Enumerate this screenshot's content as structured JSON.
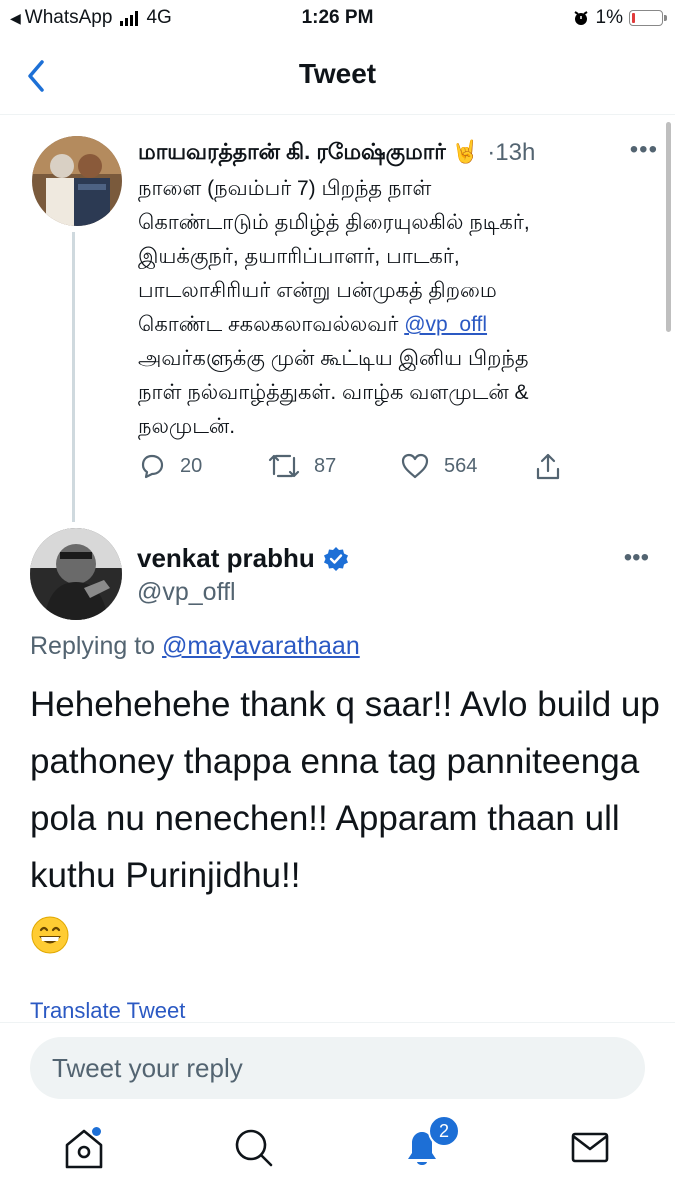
{
  "status_bar": {
    "back_app": "WhatsApp",
    "network": "4G",
    "time": "1:26 PM",
    "battery": "1%",
    "battery_level": 0.01
  },
  "nav": {
    "title": "Tweet",
    "back_icon": "chevron-left-icon"
  },
  "tweets": [
    {
      "display_name": "மாயவரத்தான் கி. ரமேஷ்குமார் 🤘",
      "time": "·13h",
      "text_before": "நாளை (நவம்பர் 7) பிறந்த நாள்\nகொண்டாடும் தமிழ்த் திரையுலகில் நடிகர்,\nஇயக்குநர், தயாரிப்பாளர், பாடகர்,\nபாடலாசிரியர் என்று பன்முகத் திறமை\nகொண்ட சகலகலாவல்லவர் ",
      "mention": "@vp_offl",
      "text_after": "\nஅவர்களுக்கு முன் கூட்டிய இனிய பிறந்த\nநாள் நல்வாழ்த்துகள். வாழ்க வளமுடன் &\nநலமுடன்.",
      "replies": "20",
      "retweets": "87",
      "likes": "564"
    },
    {
      "display_name": "venkat prabhu",
      "handle": "@vp_offl",
      "verified": true,
      "replying_label": "Replying to",
      "replying_to": "@mayavarathaan",
      "text": "Hehehehehe thank q saar!! Avlo build up pathoney thappa enna tag panniteenga pola nu nenechen!! Apparam thaan ull kuthu Purinjidhu!!",
      "emoji": "grinning-face-with-smiling-eyes"
    }
  ],
  "translate_label": "Translate Tweet",
  "reply": {
    "placeholder": "Tweet your reply"
  },
  "tabbar": {
    "home_icon": "home-icon",
    "search_icon": "search-icon",
    "notifications_icon": "bell-icon",
    "notifications_count": "2",
    "messages_icon": "mail-icon"
  },
  "colors": {
    "accent": "#1d9bf0",
    "link": "#2b59c3",
    "muted": "#536471",
    "badge": "#1d6fd6"
  }
}
